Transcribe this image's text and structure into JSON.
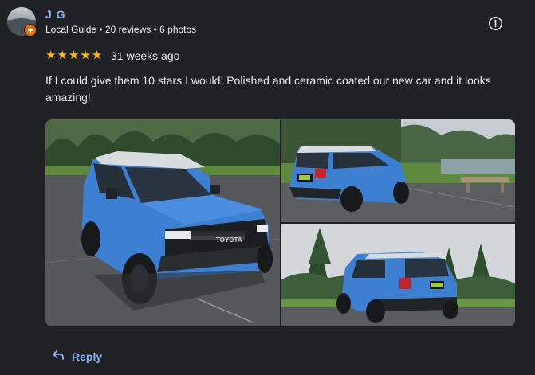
{
  "review": {
    "author": "J G",
    "author_meta": "Local Guide • 20 reviews • 6 photos",
    "rating": 5,
    "stars": [
      "★",
      "★",
      "★",
      "★",
      "★"
    ],
    "time": "31 weeks ago",
    "text": "If I could give them 10 stars I would! Polished and ceramic coated our new car and it looks amazing!",
    "photos": [
      "front-view-photo",
      "rear-view-photo-parking",
      "rear-view-photo-trees"
    ],
    "plate_text": "TOYOTA"
  },
  "actions": {
    "reply_label": "Reply",
    "reply_icon": "reply-arrow-icon",
    "report_icon": "report-icon"
  },
  "colors": {
    "background": "#202124",
    "link": "#8ab4f8",
    "star": "#fbbc04",
    "guide_badge": "#e8710a",
    "car_body": "#3d7fd0"
  }
}
